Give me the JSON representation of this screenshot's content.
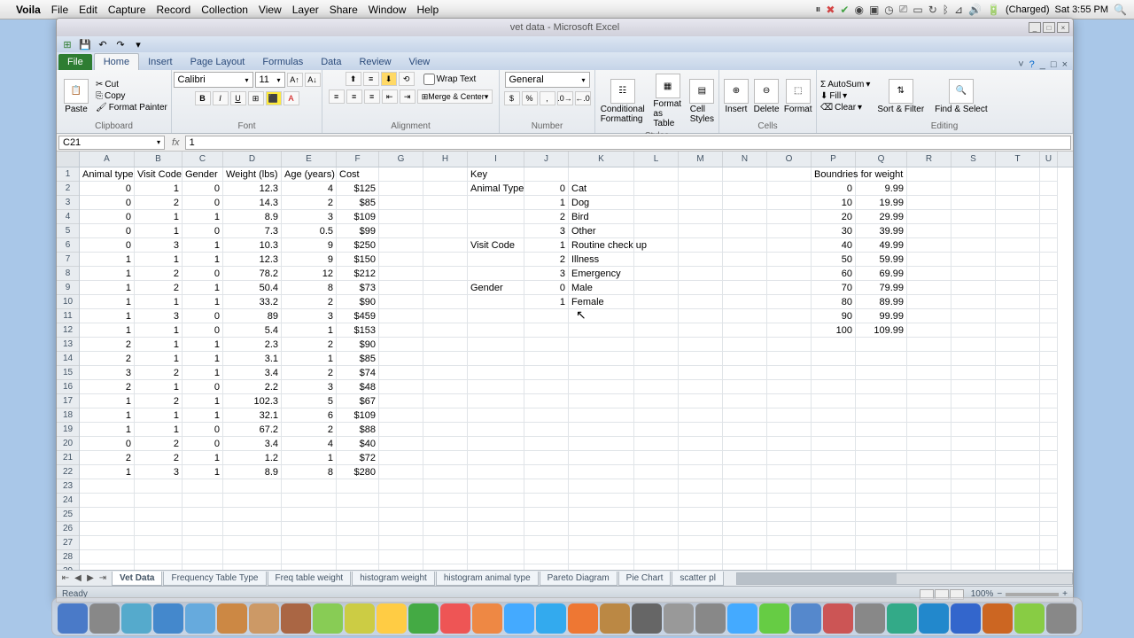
{
  "mac": {
    "app": "Voila",
    "menus": [
      "File",
      "Edit",
      "Capture",
      "Record",
      "Collection",
      "View",
      "Layer",
      "Share",
      "Window",
      "Help"
    ],
    "battery": "(Charged)",
    "clock": "Sat 3:55 PM"
  },
  "window": {
    "title": "vet data - Microsoft Excel"
  },
  "ribbon": {
    "tabs": [
      "File",
      "Home",
      "Insert",
      "Page Layout",
      "Formulas",
      "Data",
      "Review",
      "View"
    ],
    "active_tab": "Home",
    "clipboard": {
      "paste": "Paste",
      "cut": "Cut",
      "copy": "Copy",
      "fmtpaint": "Format Painter",
      "label": "Clipboard"
    },
    "font": {
      "name": "Calibri",
      "size": "11",
      "label": "Font"
    },
    "alignment": {
      "wrap": "Wrap Text",
      "merge": "Merge & Center",
      "label": "Alignment"
    },
    "number": {
      "format": "General",
      "label": "Number"
    },
    "styles": {
      "cond": "Conditional Formatting",
      "fmttbl": "Format as Table",
      "cellsty": "Cell Styles",
      "label": "Styles"
    },
    "cells": {
      "insert": "Insert",
      "delete": "Delete",
      "format": "Format",
      "label": "Cells"
    },
    "editing": {
      "autosum": "AutoSum",
      "fill": "Fill",
      "clear": "Clear",
      "sort": "Sort & Filter",
      "find": "Find & Select",
      "label": "Editing"
    }
  },
  "namebox": "C21",
  "formula": "1",
  "columns": [
    "A",
    "B",
    "C",
    "D",
    "E",
    "F",
    "G",
    "H",
    "I",
    "J",
    "K",
    "L",
    "M",
    "N",
    "O",
    "P",
    "Q",
    "R",
    "S",
    "T",
    "U"
  ],
  "headers": {
    "A": "Animal type",
    "B": "Visit Code",
    "C": "Gender",
    "D": "Weight (lbs)",
    "E": "Age (years)",
    "F": "Cost",
    "I": "Key",
    "P": "Boundries for weight"
  },
  "data_rows": [
    {
      "A": "0",
      "B": "1",
      "C": "0",
      "D": "12.3",
      "E": "4",
      "F": "$125",
      "I": "Animal Type",
      "J": "0",
      "K": "Cat",
      "P": "0",
      "Q": "9.99"
    },
    {
      "A": "0",
      "B": "2",
      "C": "0",
      "D": "14.3",
      "E": "2",
      "F": "$85",
      "J": "1",
      "K": "Dog",
      "P": "10",
      "Q": "19.99"
    },
    {
      "A": "0",
      "B": "1",
      "C": "1",
      "D": "8.9",
      "E": "3",
      "F": "$109",
      "J": "2",
      "K": "Bird",
      "P": "20",
      "Q": "29.99"
    },
    {
      "A": "0",
      "B": "1",
      "C": "0",
      "D": "7.3",
      "E": "0.5",
      "F": "$99",
      "J": "3",
      "K": "Other",
      "P": "30",
      "Q": "39.99"
    },
    {
      "A": "0",
      "B": "3",
      "C": "1",
      "D": "10.3",
      "E": "9",
      "F": "$250",
      "I": "Visit Code",
      "J": "1",
      "K": "Routine check up",
      "P": "40",
      "Q": "49.99"
    },
    {
      "A": "1",
      "B": "1",
      "C": "1",
      "D": "12.3",
      "E": "9",
      "F": "$150",
      "J": "2",
      "K": "Illness",
      "P": "50",
      "Q": "59.99"
    },
    {
      "A": "1",
      "B": "2",
      "C": "0",
      "D": "78.2",
      "E": "12",
      "F": "$212",
      "J": "3",
      "K": "Emergency",
      "P": "60",
      "Q": "69.99"
    },
    {
      "A": "1",
      "B": "2",
      "C": "1",
      "D": "50.4",
      "E": "8",
      "F": "$73",
      "I": "Gender",
      "J": "0",
      "K": "Male",
      "P": "70",
      "Q": "79.99"
    },
    {
      "A": "1",
      "B": "1",
      "C": "1",
      "D": "33.2",
      "E": "2",
      "F": "$90",
      "J": "1",
      "K": "Female",
      "P": "80",
      "Q": "89.99"
    },
    {
      "A": "1",
      "B": "3",
      "C": "0",
      "D": "89",
      "E": "3",
      "F": "$459",
      "P": "90",
      "Q": "99.99"
    },
    {
      "A": "1",
      "B": "1",
      "C": "0",
      "D": "5.4",
      "E": "1",
      "F": "$153",
      "P": "100",
      "Q": "109.99"
    },
    {
      "A": "2",
      "B": "1",
      "C": "1",
      "D": "2.3",
      "E": "2",
      "F": "$90"
    },
    {
      "A": "2",
      "B": "1",
      "C": "1",
      "D": "3.1",
      "E": "1",
      "F": "$85"
    },
    {
      "A": "3",
      "B": "2",
      "C": "1",
      "D": "3.4",
      "E": "2",
      "F": "$74"
    },
    {
      "A": "2",
      "B": "1",
      "C": "0",
      "D": "2.2",
      "E": "3",
      "F": "$48"
    },
    {
      "A": "1",
      "B": "2",
      "C": "1",
      "D": "102.3",
      "E": "5",
      "F": "$67"
    },
    {
      "A": "1",
      "B": "1",
      "C": "1",
      "D": "32.1",
      "E": "6",
      "F": "$109"
    },
    {
      "A": "1",
      "B": "1",
      "C": "0",
      "D": "67.2",
      "E": "2",
      "F": "$88"
    },
    {
      "A": "0",
      "B": "2",
      "C": "0",
      "D": "3.4",
      "E": "4",
      "F": "$40"
    },
    {
      "A": "2",
      "B": "2",
      "C": "1",
      "D": "1.2",
      "E": "1",
      "F": "$72"
    },
    {
      "A": "1",
      "B": "3",
      "C": "1",
      "D": "8.9",
      "E": "8",
      "F": "$280"
    }
  ],
  "sheets": [
    "Vet Data",
    "Frequency Table Type",
    "Freq table weight",
    "histogram weight",
    "histogram animal type",
    "Pareto Diagram",
    "Pie Chart",
    "scatter pl"
  ],
  "active_sheet": "Vet Data",
  "status": {
    "ready": "Ready",
    "zoom": "100%"
  }
}
